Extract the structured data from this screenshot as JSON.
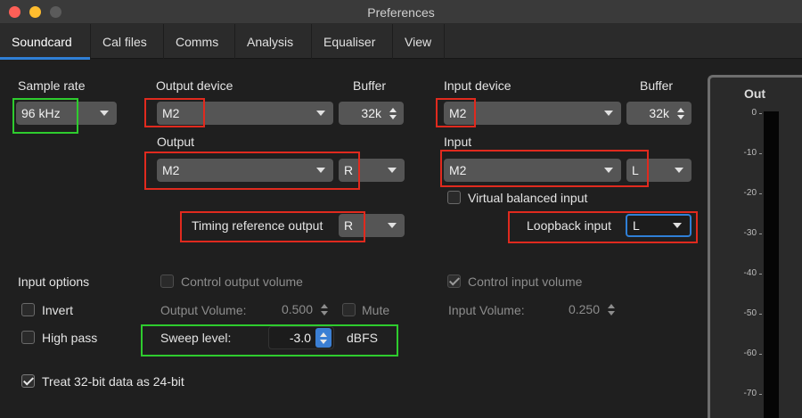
{
  "window": {
    "title": "Preferences"
  },
  "tabs": [
    {
      "label": "Soundcard"
    },
    {
      "label": "Cal files"
    },
    {
      "label": "Comms"
    },
    {
      "label": "Analysis"
    },
    {
      "label": "Equaliser"
    },
    {
      "label": "View"
    }
  ],
  "sample_rate": {
    "label": "Sample rate",
    "value": "96 kHz"
  },
  "output_device": {
    "label": "Output device",
    "value": "M2",
    "buffer_label": "Buffer",
    "buffer_value": "32k"
  },
  "output": {
    "label": "Output",
    "device": "M2",
    "channel": "R"
  },
  "timing_reference": {
    "label": "Timing reference output",
    "value": "R"
  },
  "input_device": {
    "label": "Input device",
    "value": "M2",
    "buffer_label": "Buffer",
    "buffer_value": "32k"
  },
  "input": {
    "label": "Input",
    "device": "M2",
    "channel": "L"
  },
  "virtual_balanced": {
    "label": "Virtual balanced input",
    "checked": false
  },
  "loopback": {
    "label": "Loopback input",
    "value": "L"
  },
  "input_options": {
    "label": "Input options",
    "invert": {
      "label": "Invert",
      "checked": false
    },
    "high_pass": {
      "label": "High pass",
      "checked": false
    },
    "treat_32bit": {
      "label": "Treat 32-bit data as 24-bit",
      "checked": true
    }
  },
  "output_volume": {
    "control_label": "Control output volume",
    "control_checked": false,
    "label": "Output Volume:",
    "value": "0.500",
    "mute_label": "Mute",
    "mute_checked": false
  },
  "sweep": {
    "label": "Sweep level:",
    "value": "-3.0",
    "unit": "dBFS"
  },
  "input_volume": {
    "control_label": "Control input volume",
    "control_checked": true,
    "label": "Input Volume:",
    "value": "0.250"
  },
  "meter": {
    "title": "Out",
    "ticks": [
      "0",
      "-10",
      "-20",
      "-30",
      "-40",
      "-50",
      "-60",
      "-70"
    ]
  },
  "colors": {
    "accent": "#2f7fd6",
    "highlight_red": "#e02a1e",
    "highlight_green": "#2ecc2e"
  }
}
